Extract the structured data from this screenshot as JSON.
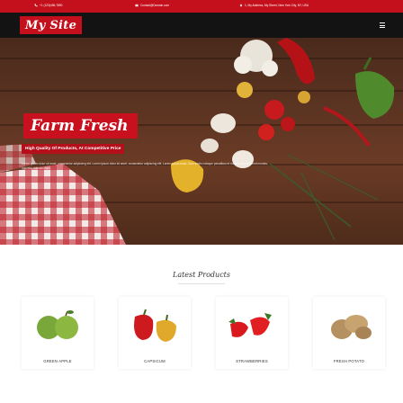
{
  "topbar": {
    "phone": "+1 (123)456-7890",
    "email": "Contact@Domain.com",
    "address": "1, My Address, My Street, New York City, NY, USA"
  },
  "nav": {
    "logo": "My Site"
  },
  "hero": {
    "title": "Farm Fresh",
    "subtitle": "High Quality Of Products, At Competitive Price",
    "body": "Lorem ipsum dolor sit amet, consectetur adipiscing elit. Lorem ipsum dolor sit amet, consectetur adipiscing elit. Lorem ipsum dolor. Cum sociis natoque penatibus et magnis dis parturient montes, nascetur ridiculus mus."
  },
  "products": {
    "heading": "Latest Products",
    "items": [
      {
        "name": "GREEN APPLE"
      },
      {
        "name": "CAPSICUM"
      },
      {
        "name": "STRAWBERRIES"
      },
      {
        "name": "FRESH POTATO"
      }
    ]
  },
  "colors": {
    "brand_red": "#c4101c",
    "nav_dark": "#131313"
  }
}
